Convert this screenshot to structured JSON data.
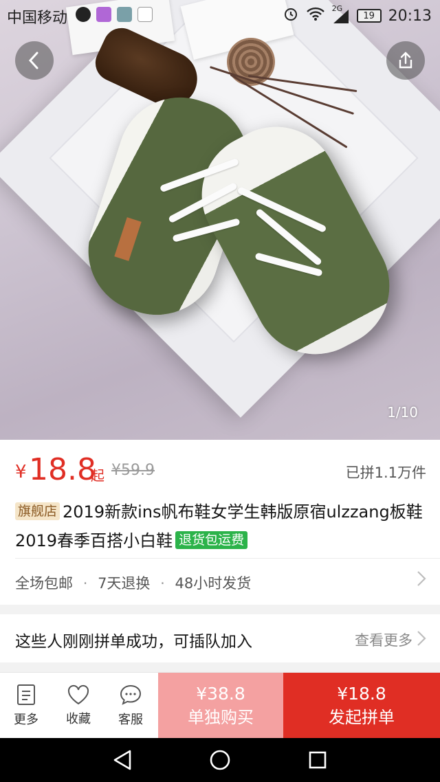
{
  "status_bar": {
    "carrier": "中国移动",
    "network": "2G",
    "battery": "19",
    "time": "20:13"
  },
  "gallery": {
    "counter": "1/10",
    "back_icon": "back-arrow-icon",
    "share_icon": "share-icon"
  },
  "price": {
    "currency": "¥",
    "value": "18.8",
    "suffix": "起",
    "original": "¥59.9",
    "sold": "已拼1.1万件"
  },
  "product": {
    "store_badge": "旗舰店",
    "title": "2019新款ins帆布鞋女学生韩版原宿ulzzang板鞋2019春季百搭小白鞋",
    "return_badge": "退货包运费"
  },
  "services": {
    "items": [
      "全场包邮",
      "7天退换",
      "48小时发货"
    ],
    "separator": "·"
  },
  "group": {
    "title": "这些人刚刚拼单成功，可插队加入",
    "more": "查看更多"
  },
  "actions": {
    "more": "更多",
    "favorite": "收藏",
    "service": "客服",
    "buy_alone_price": "¥38.8",
    "buy_alone_label": "单独购买",
    "buy_group_price": "¥18.8",
    "buy_group_label": "发起拼单"
  },
  "colors": {
    "accent_red": "#e02e24",
    "light_red": "#f4a1a1",
    "badge_green": "#2cb34a",
    "badge_gold_bg": "#f5e5c8"
  }
}
